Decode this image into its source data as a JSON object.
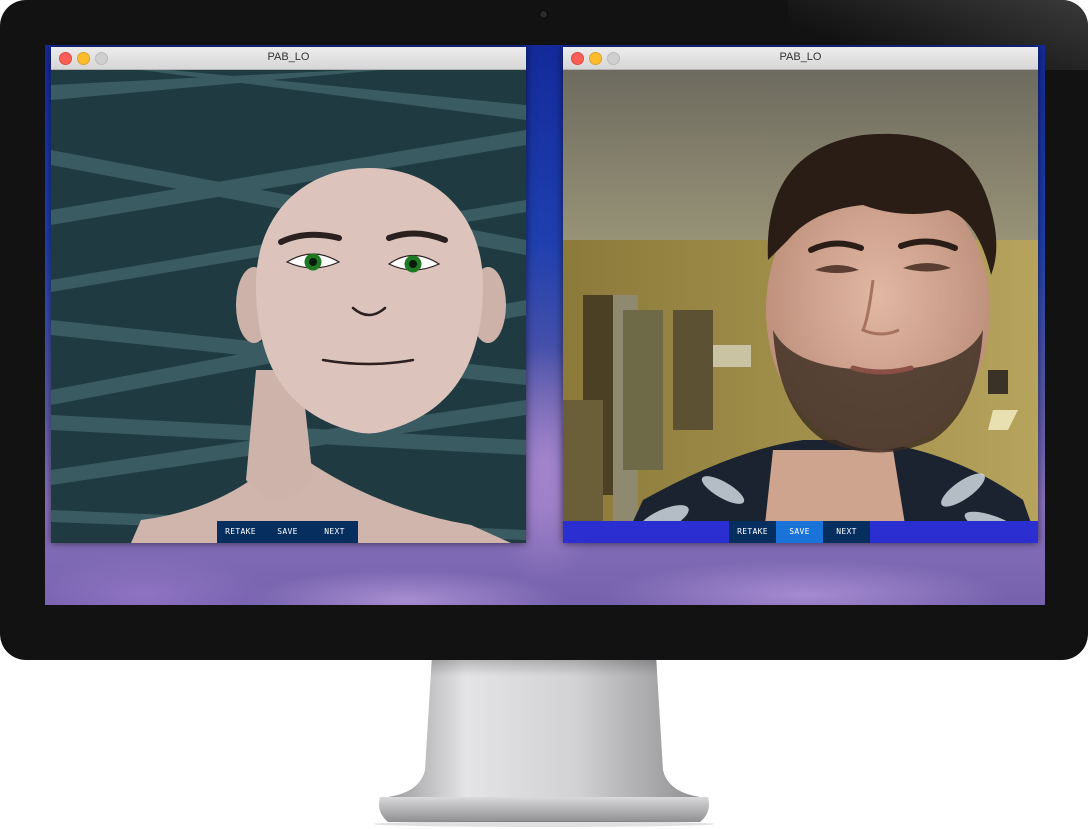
{
  "windows": [
    {
      "title": "PAB_LO",
      "toolbar": {
        "retake": "RETAKE",
        "save": "SAVE",
        "next": "NEXT"
      },
      "content": "avatar-illustration"
    },
    {
      "title": "PAB_LO",
      "toolbar": {
        "retake": "RETAKE",
        "save": "SAVE",
        "next": "NEXT",
        "active": "save"
      },
      "content": "webcam-photo"
    }
  ],
  "colors": {
    "avatar_background": "#1f3b41",
    "skin": "#dcc4bd",
    "eye_iris": "#1e7a22",
    "toolbar_button": "#062f60",
    "toolbar_active": "#1a73d8",
    "toolbar_bar": "#2b2ed1"
  }
}
